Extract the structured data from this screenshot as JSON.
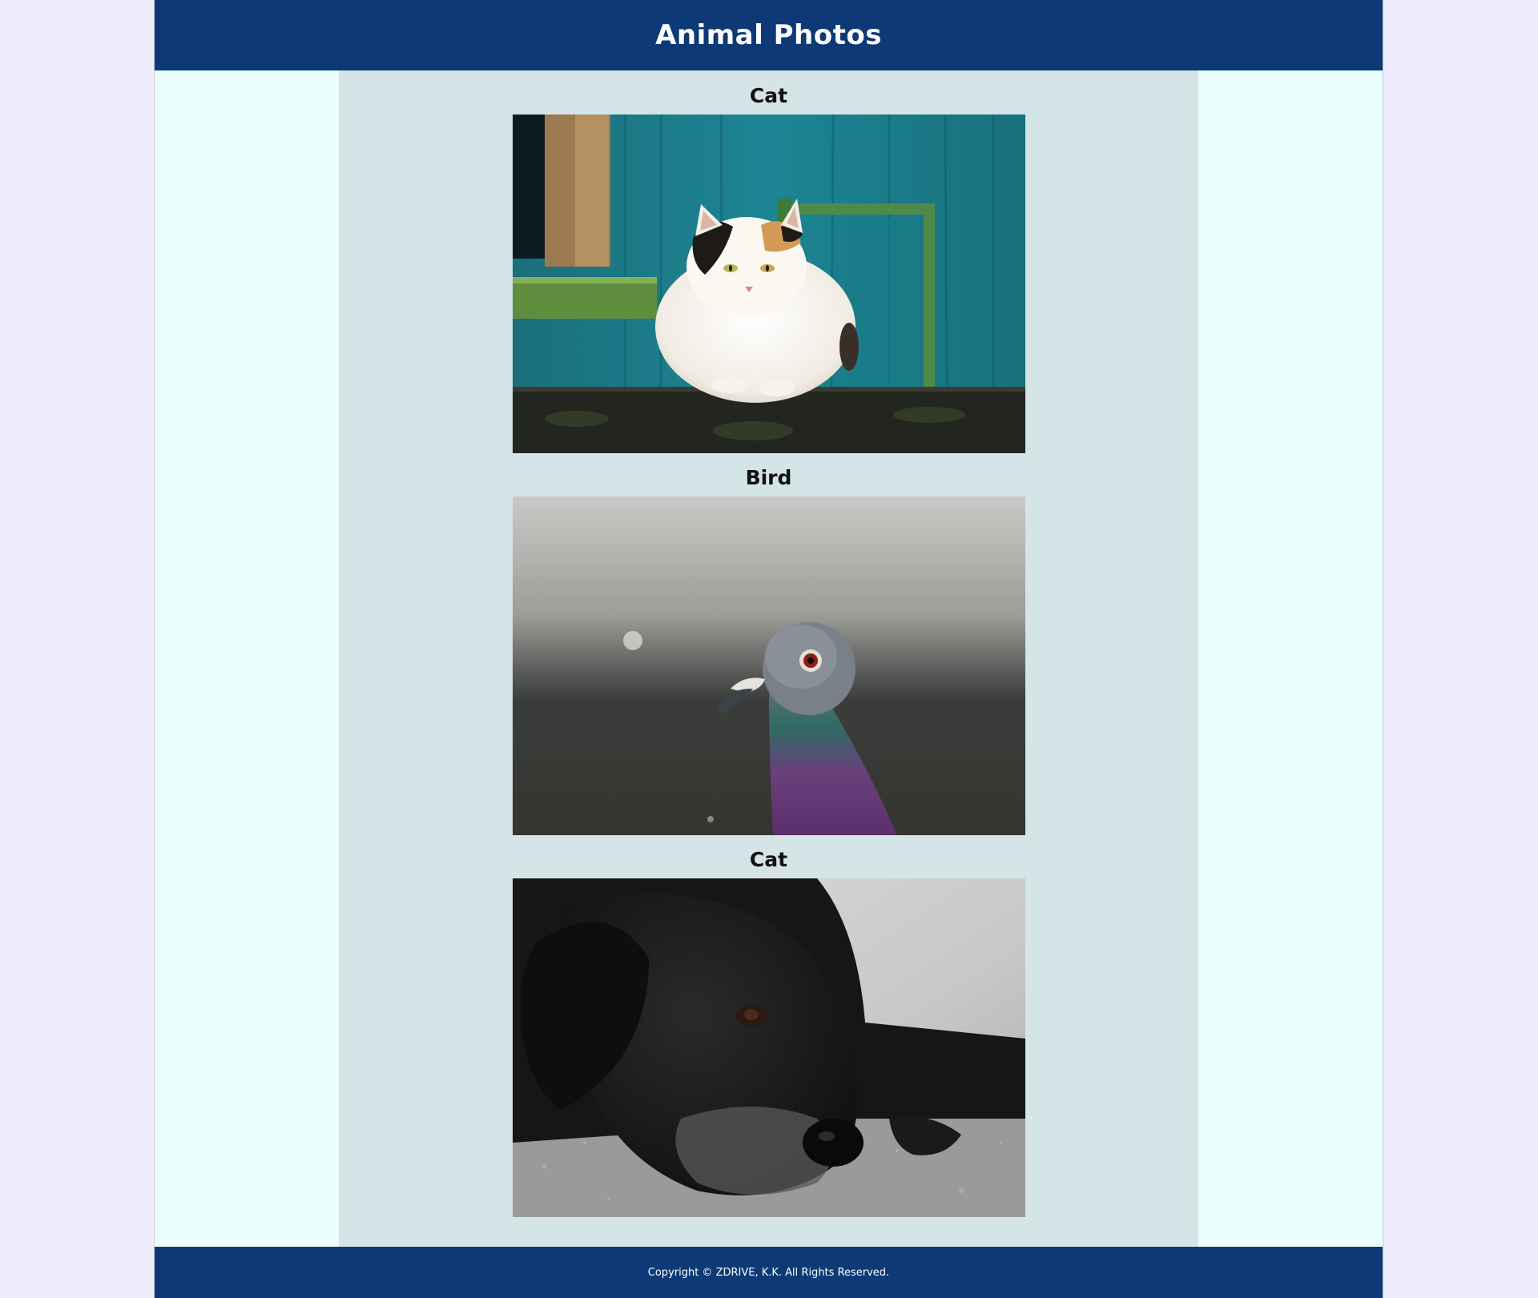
{
  "header": {
    "title": "Animal Photos"
  },
  "photos": [
    {
      "caption": "Cat",
      "image_subject": "calico-cat"
    },
    {
      "caption": "Bird",
      "image_subject": "pigeon"
    },
    {
      "caption": "Cat",
      "image_subject": "black-dog"
    }
  ],
  "footer": {
    "copyright": "Copyright © ZDRIVE, K.K. All Rights Reserved."
  },
  "colors": {
    "brand_navy": "#0d3a77",
    "page_outer": "#efedfd",
    "page_bg": "#ebfffd",
    "content_bg": "#d4e4e7"
  }
}
